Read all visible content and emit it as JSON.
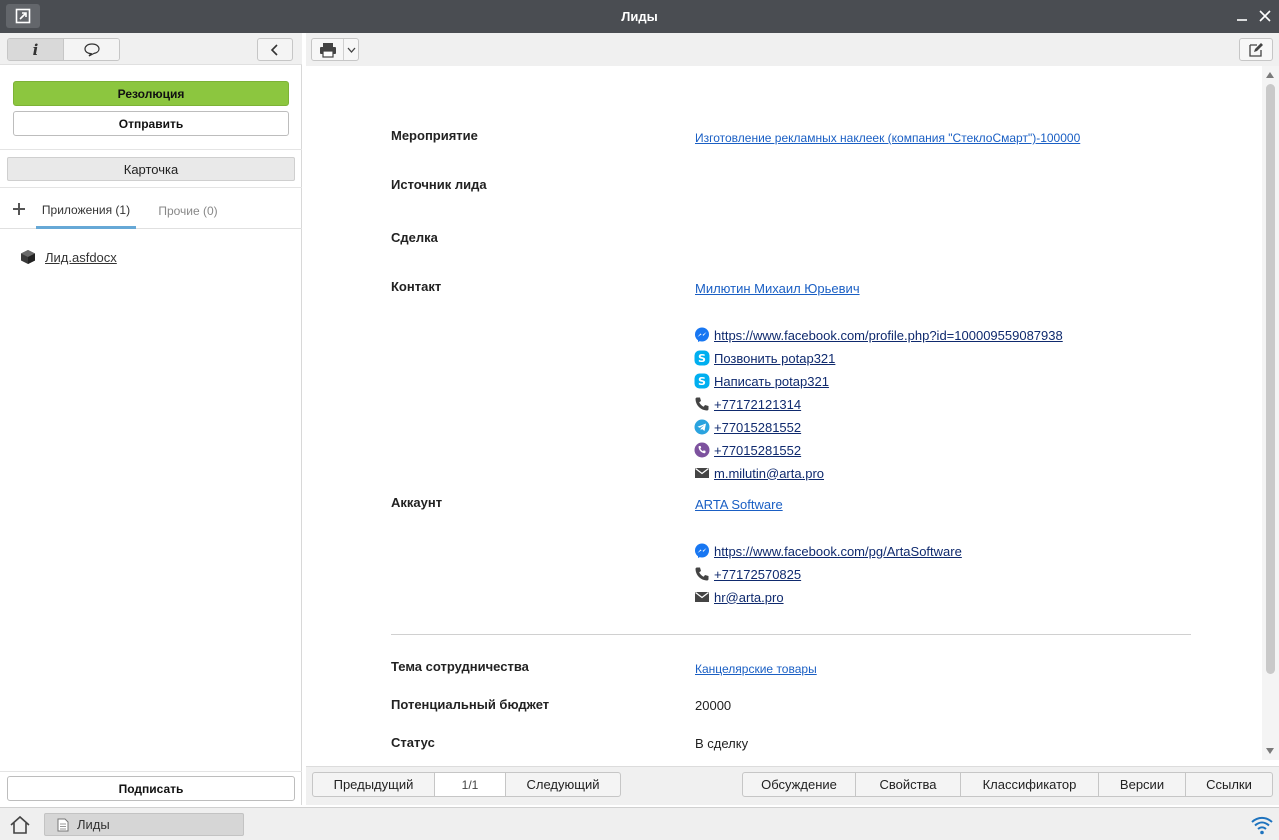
{
  "window": {
    "title": "Лиды"
  },
  "left_panel": {
    "resolution_label": "Резолюция",
    "send_label": "Отправить",
    "card_label": "Карточка",
    "tabs": [
      {
        "label": "Приложения (1)",
        "active": true
      },
      {
        "label": "Прочие (0)",
        "active": false
      }
    ],
    "file_name": "Лид.asfdocx",
    "sign_label": "Подписать"
  },
  "doc": {
    "fields": {
      "event": {
        "label": "Мероприятие",
        "value": "Изготовление рекламных наклеек (компания \"СтеклоСмарт\")-100000"
      },
      "source": {
        "label": "Источник лида",
        "value": ""
      },
      "deal": {
        "label": "Сделка",
        "value": ""
      },
      "contact": {
        "label": "Контакт",
        "name": "Милютин Михаил Юрьевич",
        "channels": [
          {
            "icon": "messenger-icon",
            "text": "https://www.facebook.com/profile.php?id=100009559087938"
          },
          {
            "icon": "skype-icon",
            "text": "Позвонить potap321"
          },
          {
            "icon": "skype-icon",
            "text": "Написать potap321"
          },
          {
            "icon": "phone-icon",
            "text": "+77172121314"
          },
          {
            "icon": "telegram-icon",
            "text": "+77015281552"
          },
          {
            "icon": "viber-icon",
            "text": "+77015281552"
          },
          {
            "icon": "email-icon",
            "text": "m.milutin@arta.pro"
          }
        ]
      },
      "account": {
        "label": "Аккаунт",
        "name": "ARTA Software",
        "channels": [
          {
            "icon": "messenger-icon",
            "text": "https://www.facebook.com/pg/ArtaSoftware"
          },
          {
            "icon": "phone-icon",
            "text": "+77172570825"
          },
          {
            "icon": "email-icon",
            "text": "hr@arta.pro"
          }
        ]
      },
      "topic": {
        "label": "Тема сотрудничества",
        "value": "Канцелярские товары"
      },
      "budget": {
        "label": "Потенциальный бюджет",
        "value": "20000"
      },
      "status": {
        "label": "Статус",
        "value": "В сделку"
      }
    }
  },
  "bottom_nav": {
    "prev_label": "Предыдущий",
    "page": "1/1",
    "next_label": "Следующий",
    "actions": [
      "Обсуждение",
      "Свойства",
      "Классификатор",
      "Версии",
      "Ссылки"
    ]
  },
  "taskbar": {
    "task_label": "Лиды"
  },
  "colors": {
    "titlebar": "#4a4d52",
    "resolution_button": "#8cc63f",
    "link": "#1a5fc4",
    "active_tab_underline": "#66a8d6",
    "messenger": "#1877f2",
    "skype": "#00aff0",
    "telegram": "#2aa3df",
    "viber": "#7d529e"
  }
}
